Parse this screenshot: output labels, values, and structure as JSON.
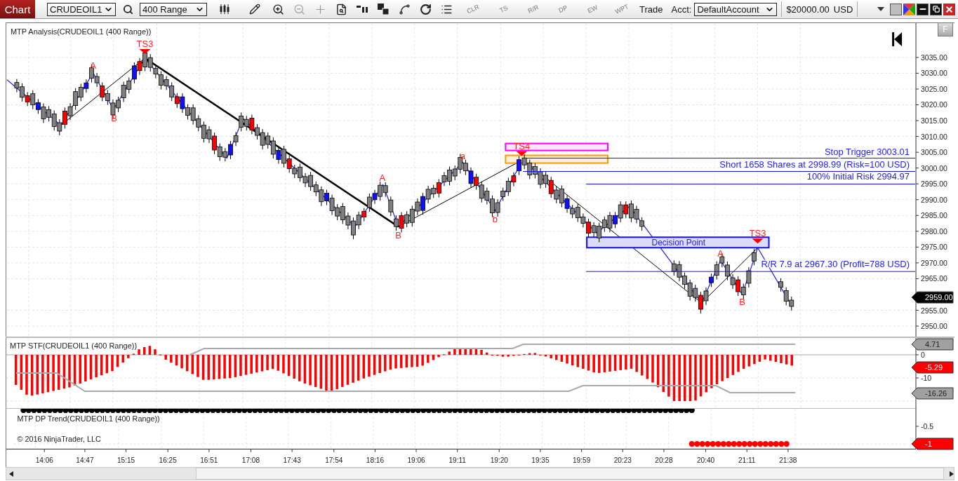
{
  "toolbar": {
    "title": "Chart",
    "instrument": "CRUDEOIL1",
    "period": "400 Range",
    "tool_buttons": [
      "CLR",
      "TS",
      "R/R",
      "DP",
      "EW",
      "WPT"
    ],
    "trade": "Trade",
    "account_label": "Acct:",
    "account": "DefaultAccount",
    "balance": "$20000.00",
    "currency": "USD"
  },
  "main_panel": {
    "title": "MTP Analysis(CRUDEOIL1 (400 Range))",
    "panel_button": "F",
    "pattern_labels": [
      {
        "text": "TS3",
        "kind": "marker"
      },
      {
        "text": "A",
        "kind": "letter"
      },
      {
        "text": "B",
        "kind": "letter"
      },
      {
        "text": "A",
        "kind": "letter"
      },
      {
        "text": "B",
        "kind": "letter"
      },
      {
        "text": "a",
        "kind": "letter"
      },
      {
        "text": "b",
        "kind": "letter"
      },
      {
        "text": "TS4",
        "kind": "marker"
      },
      {
        "text": "A",
        "kind": "letter"
      },
      {
        "text": "B",
        "kind": "letter"
      },
      {
        "text": "TS3",
        "kind": "marker"
      }
    ],
    "trade_levels": [
      "Stop Trigger 3003.01",
      "Short 1658 Shares at 2998.99 (Risk=100 USD)",
      "100% Initial Risk 2994.97",
      "R/R 7.9 at 2967.30 (Profit=788 USD)"
    ],
    "decision_zone": "Decision Point",
    "price_axis": [
      "3035.00",
      "3030.00",
      "3025.00",
      "3020.00",
      "3015.00",
      "3010.00",
      "3005.00",
      "3000.00",
      "2995.00",
      "2990.00",
      "2985.00",
      "2980.00",
      "2975.00",
      "2970.00",
      "2965.00",
      "2955.00",
      "2950.00"
    ],
    "last_price": {
      "text": "2959.00",
      "color": "#000000"
    }
  },
  "stf_panel": {
    "title": "MTP STF(CRUDEOIL1 (400 Range))",
    "axis": [
      "0",
      "-10"
    ],
    "markers": [
      {
        "text": "4.71",
        "color": "#a0a0a0"
      },
      {
        "text": "-5.29",
        "color": "#ff0000"
      },
      {
        "text": "-16.26",
        "color": "#a0a0a0"
      }
    ]
  },
  "dp_panel": {
    "title": "MTP DP Trend(CRUDEOIL1 (400 Range))",
    "copyright": "© 2016 NinjaTrader, LLC",
    "axis": [
      "-0.5"
    ],
    "marker": {
      "text": "-1",
      "color": "#ff0000"
    }
  },
  "time_axis": [
    "14:06",
    "14:47",
    "15:15",
    "16:25",
    "16:51",
    "17:08",
    "17:43",
    "17:54",
    "18:16",
    "19:06",
    "19:11",
    "19:20",
    "19:35",
    "19:59",
    "20:23",
    "20:28",
    "20:40",
    "21:11",
    "21:38"
  ]
}
